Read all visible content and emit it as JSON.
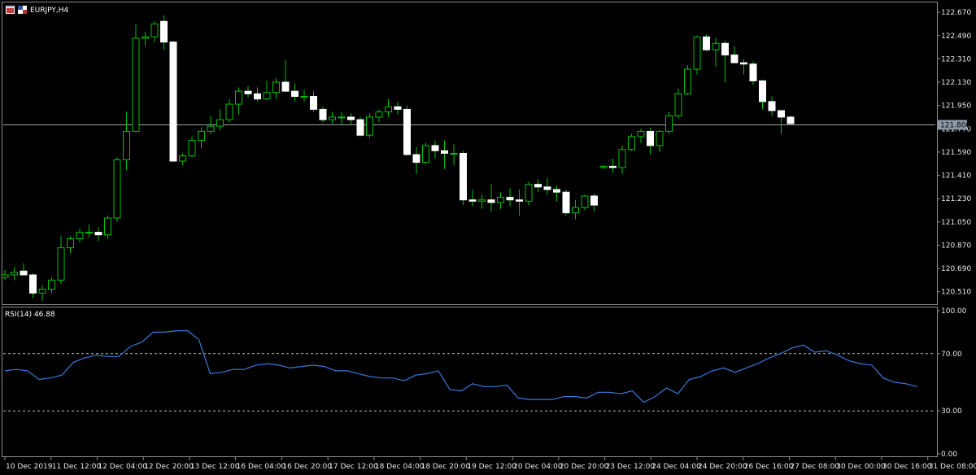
{
  "header": {
    "symbol_label": "EURJPY,H4"
  },
  "rsi_panel": {
    "label": "RSI(14) 46.88"
  },
  "colors": {
    "background": "#000000",
    "bull_wick": "#00c000",
    "bull_body": "#000000",
    "bear_body": "#ffffff",
    "bear_wick": "#00c000",
    "rsi_line": "#3a78d6",
    "grid": "#8c8c8c",
    "current_price_line": "#a0a0a0"
  },
  "icons": [
    "chart-window-icon",
    "flag-icon"
  ],
  "chart_data": [
    {
      "type": "candlestick",
      "symbol": "EURJPY",
      "timeframe": "H4",
      "ylim": [
        120.42,
        122.74
      ],
      "y_ticks": [
        "122.670",
        "122.490",
        "122.310",
        "122.130",
        "121.950",
        "121.770",
        "121.590",
        "121.410",
        "121.230",
        "121.050",
        "120.870",
        "120.690",
        "120.510"
      ],
      "current_price": "121.800",
      "x_ticks": [
        "10 Dec 2019",
        "11 Dec 12:00",
        "12 Dec 04:00",
        "12 Dec 20:00",
        "13 Dec 12:00",
        "16 Dec 04:00",
        "16 Dec 20:00",
        "17 Dec 12:00",
        "18 Dec 04:00",
        "18 Dec 20:00",
        "19 Dec 12:00",
        "20 Dec 04:00",
        "20 Dec 20:00",
        "23 Dec 12:00",
        "24 Dec 04:00",
        "24 Dec 20:00",
        "26 Dec 16:00",
        "27 Dec 08:00",
        "30 Dec 00:00",
        "30 Dec 16:00",
        "31 Dec 08:00"
      ],
      "candles": [
        [
          120.62,
          120.68,
          120.6,
          120.64
        ],
        [
          120.64,
          120.7,
          120.6,
          120.66
        ],
        [
          120.67,
          120.73,
          120.64,
          120.64
        ],
        [
          120.64,
          120.65,
          120.46,
          120.5
        ],
        [
          120.5,
          120.56,
          120.44,
          120.53
        ],
        [
          120.53,
          120.62,
          120.5,
          120.6
        ],
        [
          120.6,
          120.94,
          120.57,
          120.85
        ],
        [
          120.85,
          120.94,
          120.81,
          120.92
        ],
        [
          120.92,
          121.0,
          120.89,
          120.97
        ],
        [
          120.97,
          121.03,
          120.93,
          120.97
        ],
        [
          120.97,
          121.01,
          120.9,
          120.95
        ],
        [
          120.95,
          121.1,
          120.92,
          121.08
        ],
        [
          121.08,
          121.55,
          121.05,
          121.53
        ],
        [
          121.53,
          121.9,
          121.45,
          121.75
        ],
        [
          121.75,
          122.58,
          121.75,
          122.47
        ],
        [
          122.47,
          122.52,
          122.41,
          122.48
        ],
        [
          122.48,
          122.6,
          122.44,
          122.58
        ],
        [
          122.6,
          122.65,
          122.38,
          122.44
        ],
        [
          122.44,
          122.45,
          121.52,
          121.52
        ],
        [
          121.52,
          121.58,
          121.49,
          121.56
        ],
        [
          121.56,
          121.71,
          121.55,
          121.68
        ],
        [
          121.68,
          121.78,
          121.62,
          121.75
        ],
        [
          121.75,
          121.87,
          121.73,
          121.79
        ],
        [
          121.79,
          121.92,
          121.76,
          121.84
        ],
        [
          121.84,
          122.0,
          121.82,
          121.96
        ],
        [
          121.96,
          122.09,
          121.88,
          122.06
        ],
        [
          122.06,
          122.1,
          122.01,
          122.04
        ],
        [
          122.04,
          122.09,
          121.98,
          122.0
        ],
        [
          122.0,
          122.14,
          121.99,
          122.05
        ],
        [
          122.05,
          122.16,
          122.0,
          122.13
        ],
        [
          122.13,
          122.3,
          122.07,
          122.06
        ],
        [
          122.06,
          122.12,
          121.98,
          122.02
        ],
        [
          122.02,
          122.07,
          121.98,
          122.02
        ],
        [
          122.02,
          122.06,
          121.9,
          121.92
        ],
        [
          121.92,
          121.94,
          121.82,
          121.84
        ],
        [
          121.84,
          121.9,
          121.81,
          121.86
        ],
        [
          121.86,
          121.9,
          121.8,
          121.86
        ],
        [
          121.86,
          121.89,
          121.8,
          121.84
        ],
        [
          121.84,
          121.86,
          121.71,
          121.72
        ],
        [
          121.72,
          121.89,
          121.7,
          121.86
        ],
        [
          121.86,
          121.92,
          121.82,
          121.9
        ],
        [
          121.9,
          122.0,
          121.86,
          121.94
        ],
        [
          121.94,
          121.98,
          121.88,
          121.92
        ],
        [
          121.92,
          121.95,
          121.57,
          121.57
        ],
        [
          121.57,
          121.63,
          121.42,
          121.51
        ],
        [
          121.51,
          121.66,
          121.5,
          121.64
        ],
        [
          121.64,
          121.68,
          121.54,
          121.6
        ],
        [
          121.6,
          121.68,
          121.46,
          121.58
        ],
        [
          121.58,
          121.65,
          121.49,
          121.58
        ],
        [
          121.58,
          121.6,
          121.18,
          121.22
        ],
        [
          121.22,
          121.3,
          121.17,
          121.21
        ],
        [
          121.21,
          121.26,
          121.15,
          121.22
        ],
        [
          121.22,
          121.34,
          121.13,
          121.2
        ],
        [
          121.2,
          121.28,
          121.15,
          121.24
        ],
        [
          121.24,
          121.31,
          121.17,
          121.22
        ],
        [
          121.22,
          121.3,
          121.1,
          121.21
        ],
        [
          121.21,
          121.36,
          121.18,
          121.34
        ],
        [
          121.34,
          121.38,
          121.28,
          121.32
        ],
        [
          121.32,
          121.39,
          121.26,
          121.3
        ],
        [
          121.3,
          121.33,
          121.21,
          121.28
        ],
        [
          121.28,
          121.3,
          121.1,
          121.12
        ],
        [
          121.12,
          121.22,
          121.07,
          121.16
        ],
        [
          121.16,
          121.26,
          121.14,
          121.25
        ],
        [
          121.25,
          121.27,
          121.13,
          121.18
        ],
        [
          121.47,
          121.49,
          121.46,
          121.48
        ],
        [
          121.48,
          121.54,
          121.43,
          121.47
        ],
        [
          121.47,
          121.64,
          121.42,
          121.61
        ],
        [
          121.61,
          121.73,
          121.6,
          121.71
        ],
        [
          121.71,
          121.77,
          121.66,
          121.75
        ],
        [
          121.75,
          121.78,
          121.57,
          121.64
        ],
        [
          121.64,
          121.76,
          121.59,
          121.75
        ],
        [
          121.75,
          121.9,
          121.73,
          121.87
        ],
        [
          121.87,
          122.08,
          121.85,
          122.04
        ],
        [
          122.04,
          122.26,
          122.03,
          122.23
        ],
        [
          122.23,
          122.49,
          122.19,
          122.48
        ],
        [
          122.48,
          122.5,
          122.37,
          122.38
        ],
        [
          122.38,
          122.47,
          122.25,
          122.43
        ],
        [
          122.43,
          122.45,
          122.13,
          122.34
        ],
        [
          122.34,
          122.41,
          122.28,
          122.28
        ],
        [
          122.28,
          122.31,
          122.19,
          122.27
        ],
        [
          122.27,
          122.29,
          122.11,
          122.14
        ],
        [
          122.14,
          122.15,
          121.92,
          121.98
        ],
        [
          121.98,
          122.02,
          121.87,
          121.91
        ],
        [
          121.91,
          121.9,
          121.73,
          121.86
        ],
        [
          121.86,
          121.87,
          121.8,
          121.81
        ]
      ]
    },
    {
      "type": "line",
      "series": [
        {
          "name": "RSI(14)",
          "values": [
            58,
            59,
            58,
            52,
            53,
            55,
            64,
            67,
            69,
            68,
            68,
            75,
            78,
            85,
            85,
            86,
            86,
            80,
            56,
            57,
            59,
            59,
            62,
            63,
            62,
            60,
            61,
            62,
            61,
            58,
            58,
            56,
            54,
            53,
            53,
            51,
            55,
            56,
            58,
            45,
            44,
            49,
            47,
            47,
            48,
            39,
            38,
            38,
            38,
            40,
            40,
            39,
            43,
            43,
            42,
            44,
            36,
            40,
            46,
            42,
            52,
            54,
            58,
            60,
            57,
            60,
            63,
            67,
            70,
            74,
            76,
            71,
            72,
            69,
            65,
            63,
            62,
            53,
            50,
            49,
            47
          ]
        }
      ],
      "ylim": [
        0,
        100
      ],
      "y_ticks": [
        "100.00",
        "70.00",
        "30.00",
        "0.00"
      ],
      "levels": [
        70,
        30
      ]
    }
  ]
}
